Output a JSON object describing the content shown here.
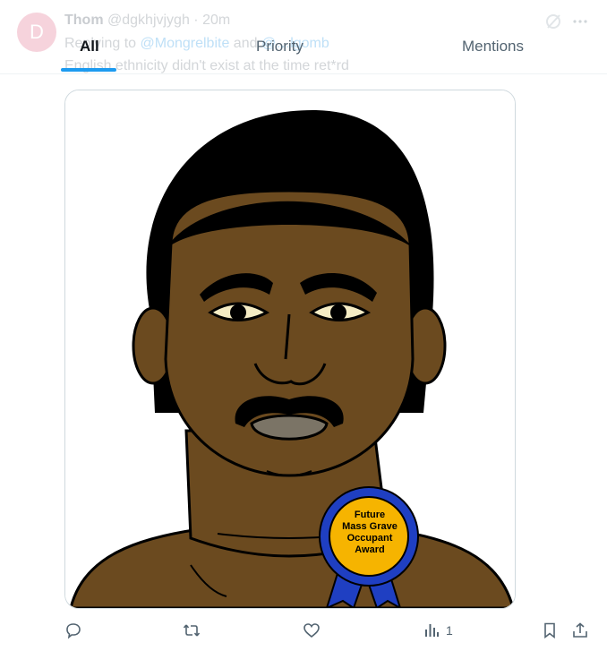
{
  "tweet": {
    "avatar_letter": "D",
    "author_name": "Thom",
    "author_handle": "@dgkhjvjygh",
    "separator": "·",
    "time": "20m",
    "replying_prefix": "Replying to",
    "replying_mention_1": "@Mongrelbite",
    "replying_and": "and",
    "replying_mention_2": "@…lgomb",
    "text": "English ethnicity didn't exist at the time ret*rd"
  },
  "tabs": [
    {
      "label": "All",
      "selected": true
    },
    {
      "label": "Priority",
      "selected": false
    },
    {
      "label": "Mentions",
      "selected": false
    }
  ],
  "media": {
    "ribbon_line_1": "Future",
    "ribbon_line_2": "Mass Grave",
    "ribbon_line_3": "Occupant",
    "ribbon_line_4": "Award"
  },
  "actions": {
    "views_count": "1"
  },
  "colors": {
    "accent": "#1d9bf0",
    "skin": "#6b4a1f",
    "ribbon_blue": "#1f3fc2",
    "ribbon_gold": "#f6b400"
  },
  "icons": {
    "reply": "reply-icon",
    "retweet": "retweet-icon",
    "like": "heart-icon",
    "views": "views-icon",
    "bookmark": "bookmark-icon",
    "share": "share-icon",
    "grok": "grok-icon",
    "more": "more-icon"
  }
}
